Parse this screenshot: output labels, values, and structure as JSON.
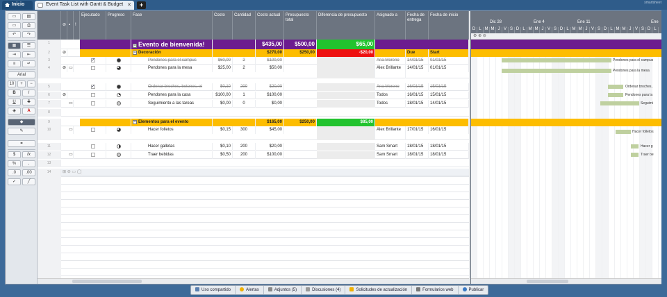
{
  "tabs": {
    "home_label": "Inicio",
    "document_label": "Event Task List with Gantt & Budget",
    "add_label": "+",
    "brand": "smartsheet"
  },
  "toolbar": {
    "font_name": "Arial",
    "font_size": "10",
    "bold": "B",
    "italic": "I",
    "underline": "U",
    "strike": "S",
    "currency": "$",
    "percent": "%",
    "formula": "fx"
  },
  "columns": {
    "executed": "Ejecutado",
    "progress": "Progreso",
    "phase": "Fase",
    "cost": "Costo",
    "quantity": "Cantidad",
    "actual_cost": "Costo actual",
    "total_budget": "Presupuesto total",
    "budget_diff": "Diferencia de presupuesto",
    "assigned": "Asignado a",
    "due_date": "Fecha de entrega",
    "start_date": "Fecha de inicio"
  },
  "rows": [
    {
      "num": "1",
      "phase": "Evento de bienvenida!",
      "actual_cost": "$435,00",
      "total_budget": "$500,00",
      "budget_diff": "$65,00"
    },
    {
      "num": "2",
      "phase": "Decoración",
      "actual_cost": "$270,00",
      "total_budget": "$250,00",
      "budget_diff": "-$20,00",
      "assigned": "Due",
      "due_date": "Start"
    },
    {
      "num": "3",
      "phase": "Pendones para el campus",
      "cost": "$60,00",
      "quantity": "2",
      "actual_cost": "$100,00",
      "assigned": "Ana Moreno",
      "due_date": "14/01/15",
      "start_date": "01/01/15"
    },
    {
      "num": "4",
      "phase": "Pendones para la mesa",
      "cost": "$25,00",
      "quantity": "2",
      "actual_cost": "$50,00",
      "assigned": "Alex Brillante",
      "due_date": "14/01/15",
      "start_date": "01/01/15"
    },
    {
      "num": "5",
      "phase": "Ordenar broches, botones, et",
      "cost": "$0,10",
      "quantity": "200",
      "actual_cost": "$20,00",
      "assigned": "Ana Moreno",
      "due_date": "16/01/15",
      "start_date": "15/01/15"
    },
    {
      "num": "6",
      "phase": "Pendones para la casa",
      "cost": "$100,00",
      "quantity": "1",
      "actual_cost": "$100,00",
      "assigned": "Todos",
      "due_date": "16/01/15",
      "start_date": "15/01/15"
    },
    {
      "num": "7",
      "phase": "Seguimiento a las tareas",
      "cost": "$0,00",
      "quantity": "0",
      "actual_cost": "$0,00",
      "assigned": "Todos",
      "due_date": "18/01/15",
      "start_date": "14/01/15"
    },
    {
      "num": "8"
    },
    {
      "num": "9",
      "phase": "Elementos para el evento",
      "actual_cost": "$165,00",
      "total_budget": "$250,00",
      "budget_diff": "$85,00"
    },
    {
      "num": "10",
      "phase": "Hacer folletos",
      "cost": "$0,15",
      "quantity": "300",
      "actual_cost": "$45,00",
      "assigned": "Alex Brillante",
      "due_date": "17/01/15",
      "start_date": "16/01/15"
    },
    {
      "num": "11",
      "phase": "Hacer galletas",
      "cost": "$0,10",
      "quantity": "200",
      "actual_cost": "$20,00",
      "assigned": "Sam Smart",
      "due_date": "18/01/15",
      "start_date": "18/01/15"
    },
    {
      "num": "12",
      "phase": "Traer bebidas",
      "cost": "$0,50",
      "quantity": "200",
      "actual_cost": "$100,00",
      "assigned": "Sam Smart",
      "due_date": "18/01/15",
      "start_date": "18/01/15"
    },
    {
      "num": "13"
    },
    {
      "num": "14"
    }
  ],
  "gantt": {
    "weeks": [
      "Dic 28",
      "Ene 4",
      "Ene 11",
      "Ene"
    ],
    "day_letters": [
      "D",
      "L",
      "M",
      "M",
      "J",
      "V",
      "S",
      "D",
      "L",
      "M",
      "M",
      "J",
      "V",
      "S",
      "D",
      "L",
      "M",
      "M",
      "J",
      "V",
      "S",
      "D",
      "L",
      "M",
      "M",
      "J",
      "V",
      "S",
      "D",
      "L"
    ],
    "labels": [
      "Pendones para el campus",
      "Pendones para la mesa",
      "Ordenar broches,",
      "Pendones para la",
      "Seguimi",
      "Hacer folletos",
      "Hacer g",
      "Traer be"
    ]
  },
  "bottombar": {
    "shared": "Uso compartido",
    "alerts": "Alertas",
    "attachments": "Adjuntos (5)",
    "discussions": "Discusiones (4)",
    "update_requests": "Solicitudes de actualización",
    "web_forms": "Formularios web",
    "publish": "Publicar"
  }
}
